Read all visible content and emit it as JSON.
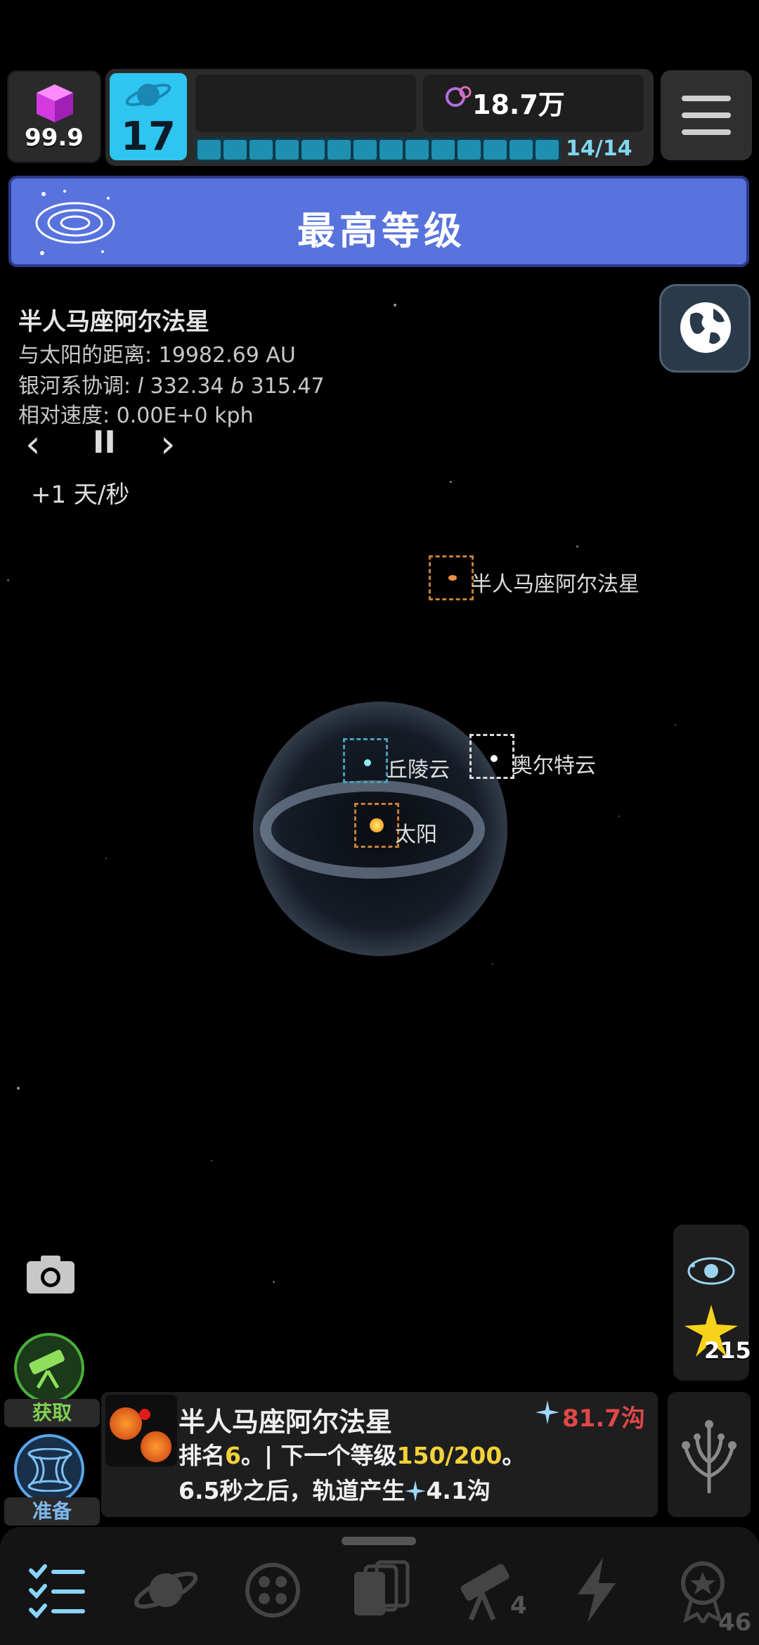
{
  "top_bar": {
    "gem_value": "99.9",
    "player_level": "17",
    "currency_value": "18.7万",
    "progress_label": "14/14",
    "progress_fraction": 1.0
  },
  "banner": {
    "title": "最高等级"
  },
  "info": {
    "title": "半人马座阿尔法星",
    "distance": "与太阳的距离: 19982.69 AU",
    "coords_prefix": "银河系协调: ",
    "coords_l": "l",
    "coords_l_val": " 332.34 ",
    "coords_b": "b",
    "coords_b_val": " 315.47",
    "velocity": "相对速度: 0.00E+0 kph",
    "prev": "‹",
    "pause": "II",
    "next": "›",
    "speed": "+1 天/秒"
  },
  "map": {
    "alpha_centauri": "半人马座阿尔法星",
    "kuiper": "丘陵云",
    "oort": "奥尔特云",
    "sun": "太阳"
  },
  "side": {
    "star_count": "215"
  },
  "left_buttons": {
    "acquire": "获取",
    "prepare": "准备"
  },
  "card": {
    "name": "半人马座阿尔法星",
    "reward": "81.7沟",
    "rank_prefix": "排名",
    "rank": "6",
    "rank_mid": "。| 下一个等级",
    "next_level": "150/200",
    "rank_suffix": "。",
    "orbit_prefix": "6.5秒之后，轨道产生",
    "orbit_value": "4.1沟"
  },
  "bottom_nav": {
    "telescope_badge": "4",
    "achievements_badge": "46"
  },
  "colors": {
    "banner": "#5873de",
    "level_box": "#2ec6f0",
    "progress": "#1f8fb0",
    "reward_red": "#e04848",
    "highlight_yellow": "#f3d23a",
    "acquire_green": "#4cae3a"
  }
}
